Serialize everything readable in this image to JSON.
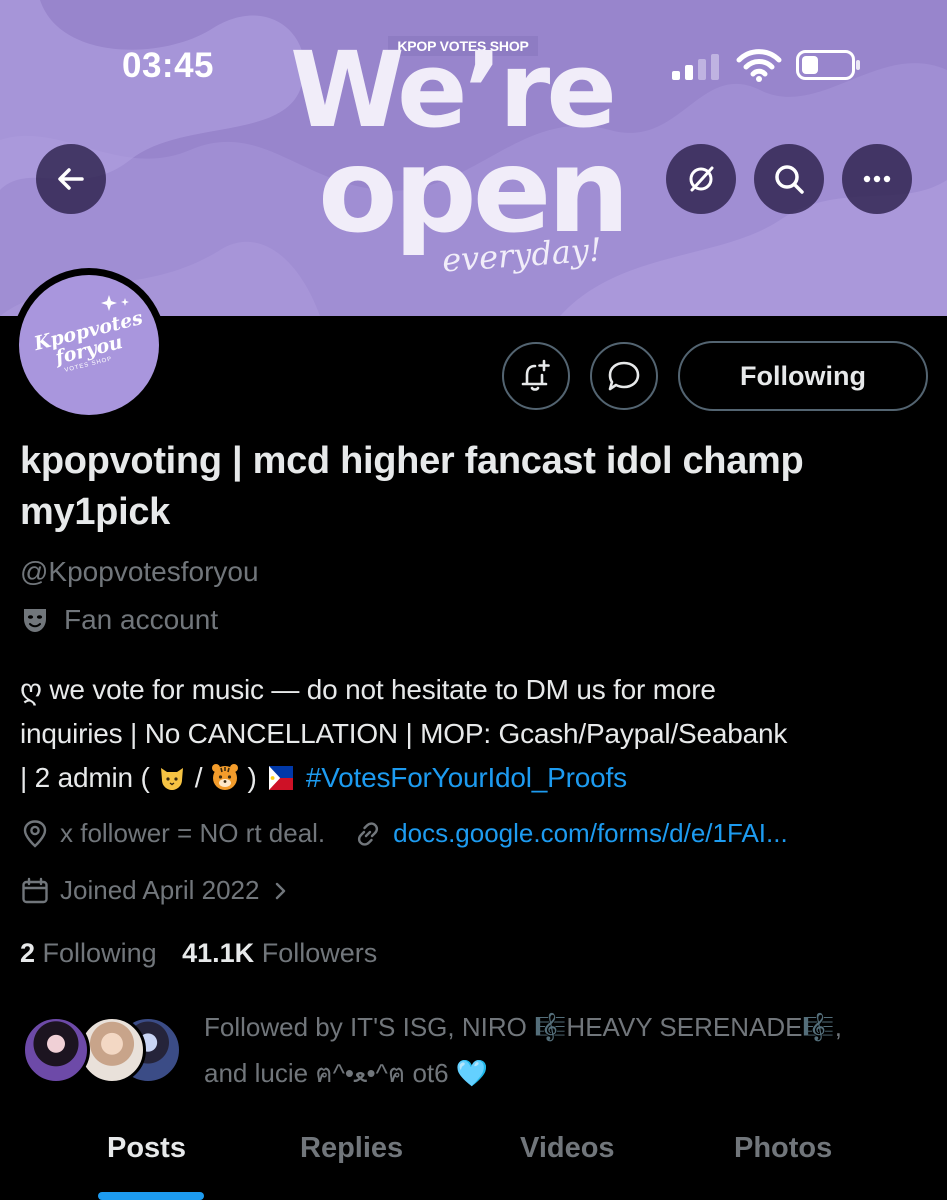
{
  "status_bar": {
    "time": "03:45"
  },
  "banner": {
    "shop_tag": "KPOP VOTES SHOP",
    "line1": "We’re",
    "line2": "open",
    "line3": "everyday!"
  },
  "avatar": {
    "logo_line1": "Kpopvotes",
    "logo_line2": "foryou",
    "logo_sub": "VOTES SHOP"
  },
  "actions": {
    "following_label": "Following"
  },
  "profile": {
    "display_name": "kpopvoting | mcd higher fancast idol champ my1pick",
    "handle": "@Kpopvotesforyou",
    "category": "Fan account",
    "bio": {
      "line1": "ღ we vote for music — do not hesitate to DM us for more",
      "line2": "inquiries | No CANCELLATION | MOP: Gcash/Paypal/Seabank",
      "line3_start": "| 2 admin (",
      "line3_sep": "/",
      "line3_end": ")",
      "hashtag": "#VotesForYourIdol_Proofs"
    },
    "location": "x follower = NO rt deal.",
    "website": "docs.google.com/forms/d/e/1FAI...",
    "joined": "Joined April 2022",
    "following_count": "2",
    "following_label": "Following",
    "followers_count": "41.1K",
    "followers_label": "Followers",
    "followed_by_line1": "Followed by IT'S ISG, NIRO 🎼HEAVY SERENADE🎼,",
    "followed_by_line2": "and lucie ฅ^•ﻌ•^ฅ ot6 🩵"
  },
  "tabs": [
    {
      "label": "Posts",
      "active": true
    },
    {
      "label": "Replies",
      "active": false
    },
    {
      "label": "Videos",
      "active": false
    },
    {
      "label": "Photos",
      "active": false
    }
  ],
  "colors": {
    "accent": "#1d9bf0",
    "banner": "#a593d6",
    "muted": "#71767b"
  }
}
